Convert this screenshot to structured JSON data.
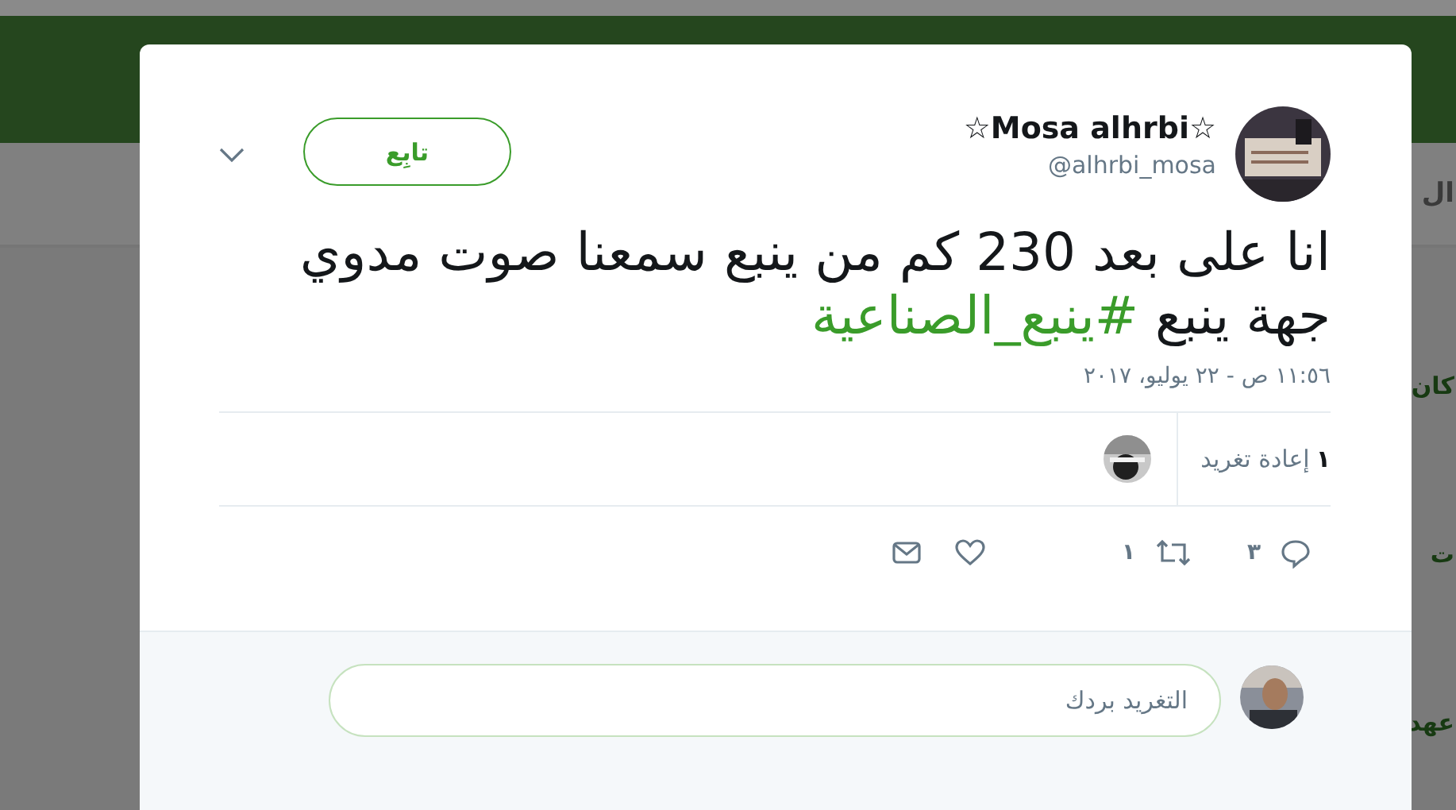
{
  "background": {
    "nav_fragment": "ال",
    "side_fragments": [
      "كان",
      "ت",
      "عهد"
    ]
  },
  "tweet": {
    "author": {
      "name": "☆Mosa alhrbi☆",
      "handle": "@alhrbi_mosa"
    },
    "follow_button": "تابِع",
    "text": "انا على بعد 230 كم من ينبع سمعنا صوت مدوي جهة ينبع ",
    "hashtag": "#ينبع_الصناعية",
    "timestamp": "١١:٥٦ ص - ٢٢ يوليو، ٢٠١٧",
    "retweets": {
      "count": "١",
      "label": "إعادة تغريد"
    },
    "actions": [
      {
        "kind": "reply",
        "count": "٣"
      },
      {
        "kind": "retweet",
        "count": "١"
      },
      {
        "kind": "like"
      },
      {
        "kind": "message"
      }
    ]
  },
  "reply": {
    "placeholder": "التغريد بردك"
  }
}
